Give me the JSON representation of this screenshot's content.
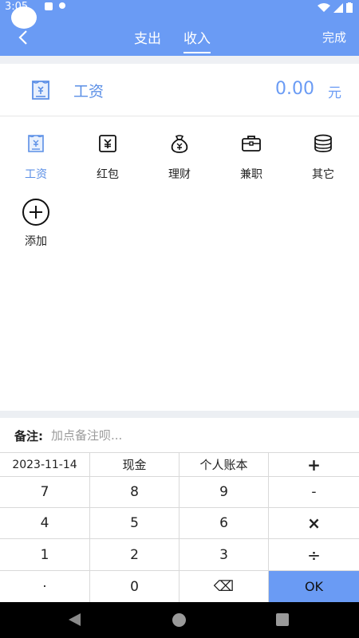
{
  "status": {
    "time": "3:05"
  },
  "header": {
    "tabs": [
      {
        "label": "支出"
      },
      {
        "label": "收入"
      }
    ],
    "active_tab": "收入",
    "done_label": "完成"
  },
  "amount": {
    "category": "工资",
    "value": "0.00",
    "unit": "元"
  },
  "categories": [
    {
      "label": "工资",
      "icon": "payslip-icon",
      "active": true
    },
    {
      "label": "红包",
      "icon": "yuan-envelope-icon"
    },
    {
      "label": "理财",
      "icon": "money-bag-icon"
    },
    {
      "label": "兼职",
      "icon": "briefcase-icon"
    },
    {
      "label": "其它",
      "icon": "coin-stack-icon"
    },
    {
      "label": "添加",
      "icon": "add-circle-icon"
    }
  ],
  "note": {
    "label": "备注:",
    "placeholder": "加点备注呗..."
  },
  "keypad": {
    "date": "2023-11-14",
    "account": "现金",
    "book": "个人账本",
    "plus": "+",
    "k7": "7",
    "k8": "8",
    "k9": "9",
    "minus": "-",
    "k4": "4",
    "k5": "5",
    "k6": "6",
    "times": "×",
    "k1": "1",
    "k2": "2",
    "k3": "3",
    "divide": "÷",
    "dot": "·",
    "k0": "0",
    "backspace": "⌫",
    "ok": "OK"
  },
  "colors": {
    "accent": "#6a9bf4",
    "accent_text": "#5b8fe6"
  }
}
